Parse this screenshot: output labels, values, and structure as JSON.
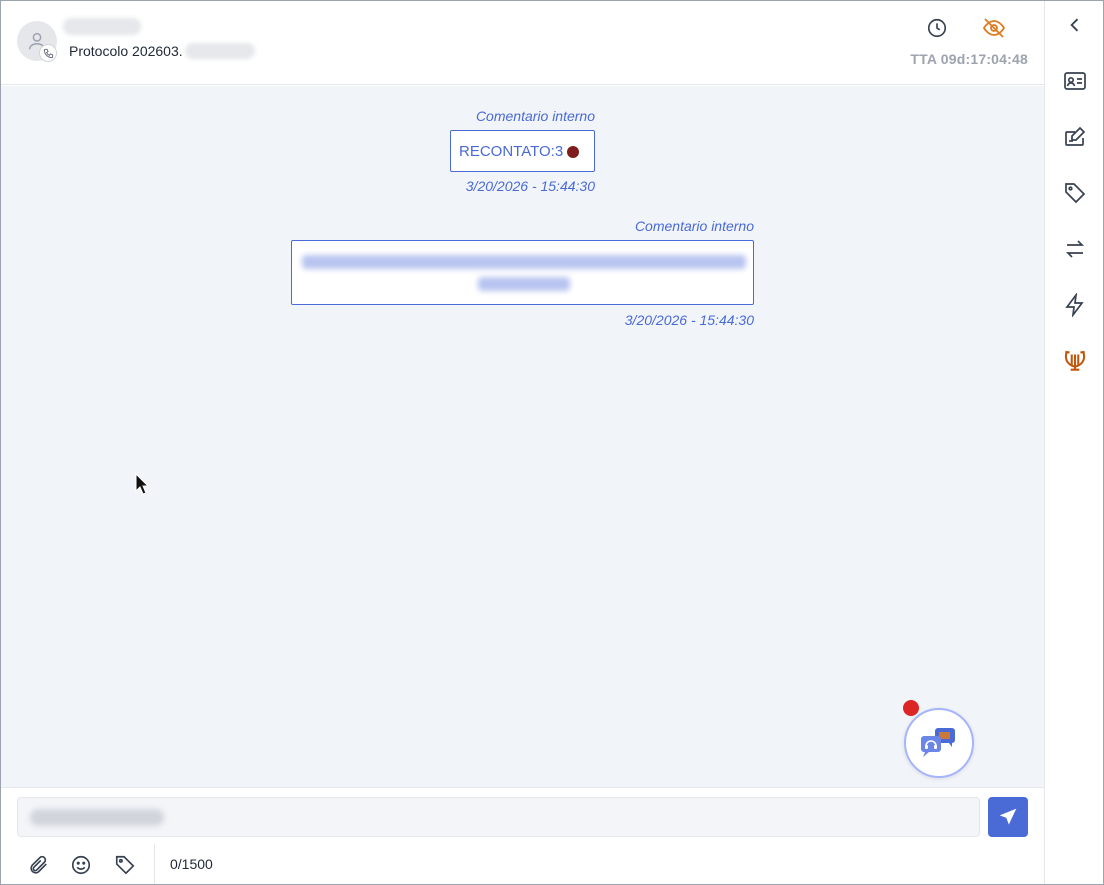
{
  "header": {
    "protocol_label": "Protocolo 202603.",
    "tta_label": "TTA 09d:17:04:48",
    "icons": [
      "clock-icon",
      "eye-off-icon"
    ]
  },
  "messages": [
    {
      "meta": "Comentario interno",
      "text": "RECONTATO:3",
      "timestamp": "3/20/2026 - 15:44:30",
      "status_color": "#7f1d1d"
    },
    {
      "meta": "Comentario interno",
      "timestamp": "3/20/2026 - 15:44:30"
    }
  ],
  "composer": {
    "char_count": "0/1500",
    "tools": [
      "paperclip-icon",
      "emoji-icon",
      "tag-icon"
    ],
    "send": "send-icon"
  },
  "sidebar": {
    "icons": [
      "chevron-left-icon",
      "contact-card-icon",
      "edit-note-icon",
      "tag-icon",
      "transfer-icon",
      "lightning-icon",
      "lyre-icon"
    ]
  },
  "colors": {
    "accent": "#4a6ad6",
    "warning": "#e07b1f",
    "notification": "#dc2626",
    "chat_bg": "#f1f4f9"
  }
}
